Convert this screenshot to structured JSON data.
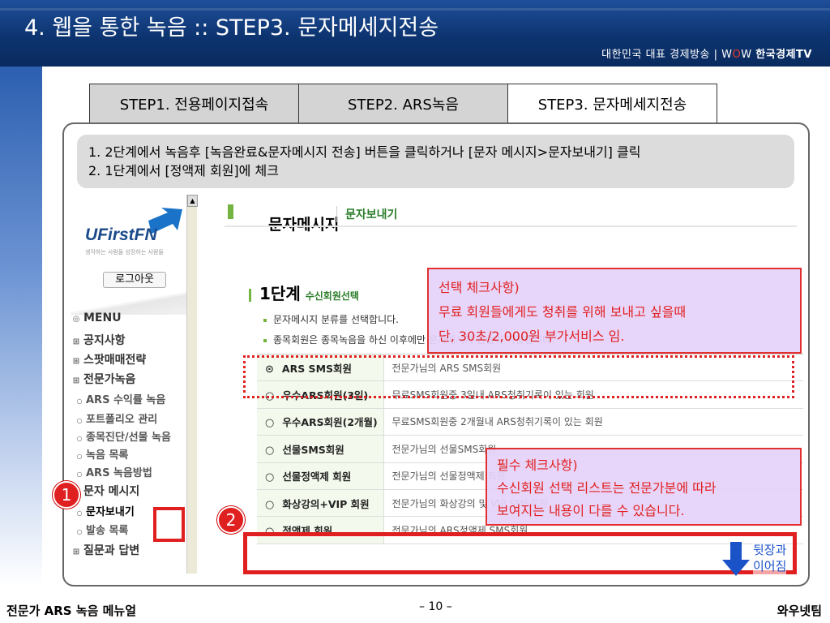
{
  "header": {
    "title": "4. 웹을 통한 녹음 :: STEP3. 문자메세지전송",
    "brand_prefix": "대한민국 대표 경제방송 | W",
    "brand_o": "O",
    "brand_w": "W",
    "brand_name": "한국경제TV"
  },
  "tabs": [
    {
      "label": "STEP1. 전용페이지접속"
    },
    {
      "label": "STEP2. ARS녹음"
    },
    {
      "label": "STEP3. 문자메세지전송"
    }
  ],
  "instructions": [
    "1. 2단계에서 녹음후 [녹음완료&문자메시지 전송] 버튼을 클릭하거나 [문자 메시지>문자보내기] 클릭",
    "2. 1단계에서 [정액제 회원]에 체크"
  ],
  "screenshot": {
    "logo": "UFirstFN",
    "logo_sub": "생각하는 사람들 성장하는 사람들",
    "logout": "로그아웃",
    "menu_title": "MENU",
    "menu": [
      {
        "label": "공지사항",
        "type": "main"
      },
      {
        "label": "스팟매매전략",
        "type": "main"
      },
      {
        "label": "전문가녹음",
        "type": "main"
      },
      {
        "label": "ARS 수익률 녹음",
        "type": "sub"
      },
      {
        "label": "포트폴리오 관리",
        "type": "sub"
      },
      {
        "label": "종목진단/선물 녹음",
        "type": "sub"
      },
      {
        "label": "녹음 목록",
        "type": "sub"
      },
      {
        "label": "ARS 녹음방법",
        "type": "sub"
      },
      {
        "label": "문자 메시지",
        "type": "main"
      },
      {
        "label": "문자보내기",
        "type": "sub"
      },
      {
        "label": "발송 목록",
        "type": "sub"
      },
      {
        "label": "질문과 답변",
        "type": "main"
      }
    ],
    "main_title": "문자메시지",
    "main_subtitle": "문자보내기",
    "step_title": "1단계",
    "step_small": "수신회원선택",
    "notes": [
      "문자메시지 분류를 선택합니다.",
      "종목회원은 종목녹음을 하신 이후에만 문자메시지 전송이 가능합니다."
    ],
    "options": [
      {
        "radio": "⊙",
        "name": "ARS SMS회원",
        "desc": "전문가님의 ARS SMS회원"
      },
      {
        "radio": "○",
        "name": "우수ARS회원(3일)",
        "desc": "무료SMS회원중 3일내 ARS청취기록이 있는 회원"
      },
      {
        "radio": "○",
        "name": "우수ARS회원(2개월)",
        "desc": "무료SMS회원중 2개월내 ARS청취기록이 있는 회원"
      },
      {
        "radio": "○",
        "name": "선물SMS회원",
        "desc": "전문가님의 선물SMS회원"
      },
      {
        "radio": "○",
        "name": "선물정액제 회원",
        "desc": "전문가님의 선물정액제 회원"
      },
      {
        "radio": "○",
        "name": "화상강의+VIP 회원",
        "desc": "전문가님의 화상강의 및 VIP SMS회원"
      },
      {
        "radio": "○",
        "name": "정액제 회원",
        "desc": "전문가님의 ARS정액제 SMS회원"
      }
    ]
  },
  "callout1": {
    "line1": "선택 체크사항)",
    "line2": "무료 회원들에게도 청취를 위해 보내고 싶을때",
    "line3": "단, 30초/2,000원 부가서비스 임."
  },
  "callout2": {
    "line1": "필수 체크사항)",
    "line2": "수신회원 선택 리스트는 전문가분에 따라",
    "line3": "보여지는 내용이 다를 수 있습니다."
  },
  "markers": {
    "n1": "1",
    "n2": "2"
  },
  "next": {
    "line1": "뒷장과",
    "line2": "이어짐"
  },
  "footer": {
    "left": "전문가 ARS 녹음 메뉴얼",
    "center": "– 10 –",
    "right": "와우넷팀"
  },
  "colors": {
    "header": "#0d3470",
    "accent_red": "#e02020",
    "green": "#74b441",
    "callout_bg": "#e6d3fa"
  }
}
